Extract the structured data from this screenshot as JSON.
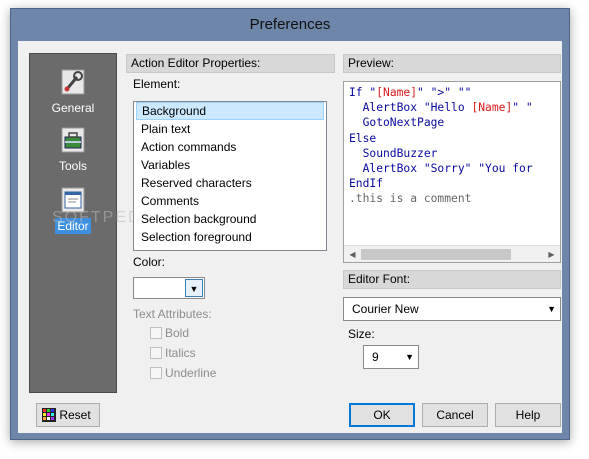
{
  "window": {
    "title": "Preferences"
  },
  "sidebar": {
    "items": [
      {
        "label": "General",
        "icon": "wrench-icon"
      },
      {
        "label": "Tools",
        "icon": "toolbox-icon"
      },
      {
        "label": "Editor",
        "icon": "editor-window-icon",
        "selected": true
      }
    ]
  },
  "action_editor": {
    "group_title": "Action Editor Properties:",
    "element_label": "Element:",
    "elements": [
      "Background",
      "Plain text",
      "Action commands",
      "Variables",
      "Reserved characters",
      "Comments",
      "Selection background",
      "Selection foreground"
    ],
    "selected_element": "Background",
    "color_label": "Color:",
    "color_value": "#ffffff",
    "text_attributes_label": "Text Attributes:",
    "bold_label": "Bold",
    "italics_label": "Italics",
    "underline_label": "Underline"
  },
  "preview": {
    "title": "Preview:",
    "lines": [
      [
        "If \"",
        "[Name]",
        "\" \">\" \"\""
      ],
      [
        "  AlertBox \"Hello ",
        "[Name]",
        "\" \""
      ],
      [
        "  GotoNextPage"
      ],
      [
        "Else"
      ],
      [
        "  SoundBuzzer"
      ],
      [
        "  AlertBox \"Sorry\" \"You for"
      ],
      [
        "EndIf"
      ],
      [
        ".this is a comment"
      ]
    ]
  },
  "editor_font": {
    "title": "Editor Font:",
    "font_value": "Courier New",
    "size_label": "Size:",
    "size_value": "9"
  },
  "buttons": {
    "reset": "Reset",
    "ok": "OK",
    "cancel": "Cancel",
    "help": "Help"
  },
  "watermark": "SOFTPEDIA",
  "colors": {
    "frame": "#6e86a9",
    "sidebar_bg": "#6b6b6b",
    "selection": "#3d8fe0",
    "code_keyword": "#0a0aa0",
    "code_variable": "#d81c1c",
    "code_comment": "#666666"
  }
}
